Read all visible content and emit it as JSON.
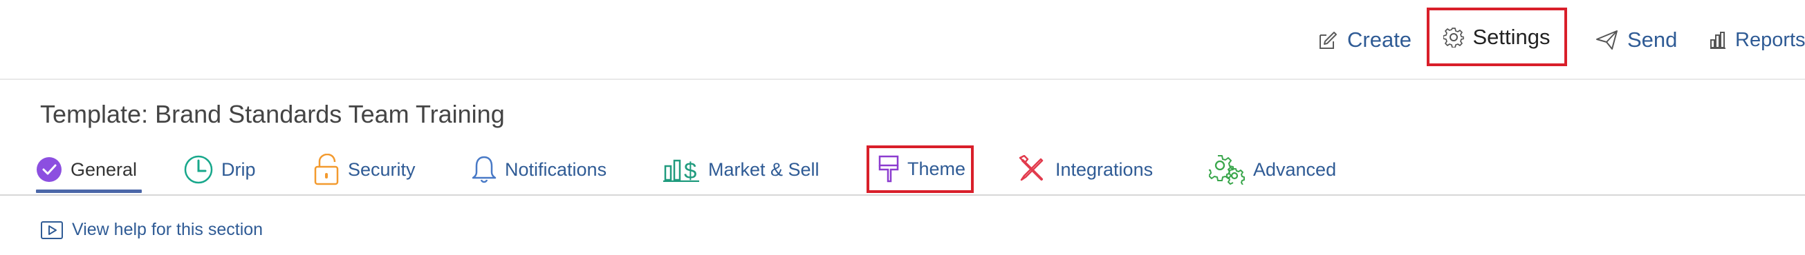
{
  "topbar": {
    "create_label": "Create",
    "settings_label": "Settings",
    "send_label": "Send",
    "reports_label": "Reports"
  },
  "template": {
    "title": "Template: Brand Standards Team Training"
  },
  "tabs": [
    {
      "label": "General",
      "icon": "check-circle-icon"
    },
    {
      "label": "Drip",
      "icon": "clock-icon"
    },
    {
      "label": "Security",
      "icon": "unlock-icon"
    },
    {
      "label": "Notifications",
      "icon": "bell-icon"
    },
    {
      "label": "Market & Sell",
      "icon": "market-sell-icon"
    },
    {
      "label": "Theme",
      "icon": "paintbrush-icon"
    },
    {
      "label": "Integrations",
      "icon": "tools-icon"
    },
    {
      "label": "Advanced",
      "icon": "gears-icon"
    }
  ],
  "help": {
    "label": "View help for this section",
    "icon": "video-play-icon"
  },
  "colors": {
    "accent": "#2f5b95",
    "highlight_border": "#d91f2a",
    "general_icon": "#8c4fe0",
    "drip_icon": "#17a78b",
    "security_icon": "#f39a2e",
    "notifications_icon": "#4879c6",
    "market_icon": "#209b7e",
    "theme_icon": "#8c3ccf",
    "integrations_icon": "#e23b4d",
    "advanced_icon": "#39a64b"
  }
}
